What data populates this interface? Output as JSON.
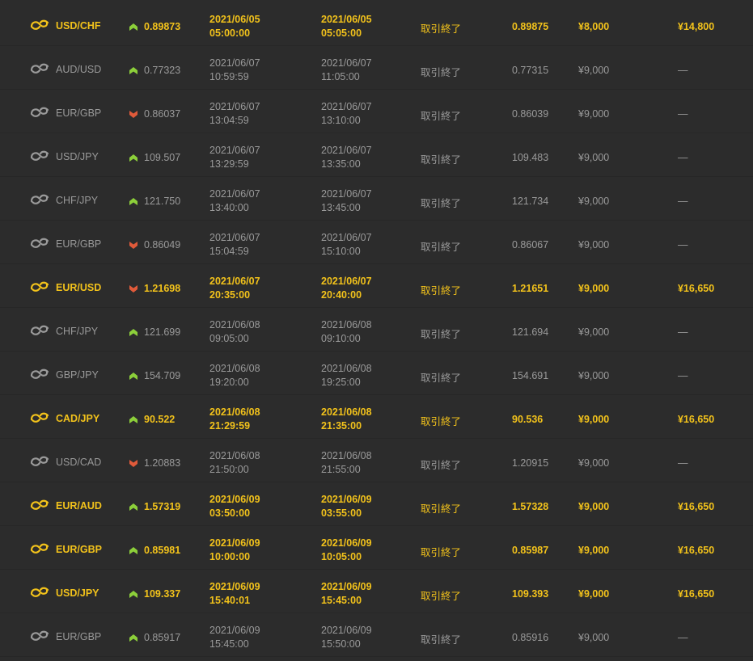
{
  "colors": {
    "background": "#2c2c2c",
    "win_text": "#f2c21b",
    "normal_text": "#9a9a9a",
    "up_arrow": "#8ccf3a",
    "down_arrow": "#e05a3a"
  },
  "icons": {
    "pair": "currency-exchange-icon",
    "up": "high-arrow-icon",
    "down": "low-arrow-icon"
  },
  "trades": [
    {
      "pair": "USD/CHF",
      "direction": "up",
      "entry_rate": "0.89873",
      "start_date": "2021/06/05",
      "start_time": "05:00:00",
      "end_date": "2021/06/05",
      "end_time": "05:05:00",
      "status": "取引終了",
      "close_rate": "0.89875",
      "invest": "¥8,000",
      "payout": "¥14,800",
      "win": true
    },
    {
      "pair": "AUD/USD",
      "direction": "up",
      "entry_rate": "0.77323",
      "start_date": "2021/06/07",
      "start_time": "10:59:59",
      "end_date": "2021/06/07",
      "end_time": "11:05:00",
      "status": "取引終了",
      "close_rate": "0.77315",
      "invest": "¥9,000",
      "payout": "—",
      "win": false
    },
    {
      "pair": "EUR/GBP",
      "direction": "down",
      "entry_rate": "0.86037",
      "start_date": "2021/06/07",
      "start_time": "13:04:59",
      "end_date": "2021/06/07",
      "end_time": "13:10:00",
      "status": "取引終了",
      "close_rate": "0.86039",
      "invest": "¥9,000",
      "payout": "—",
      "win": false
    },
    {
      "pair": "USD/JPY",
      "direction": "up",
      "entry_rate": "109.507",
      "start_date": "2021/06/07",
      "start_time": "13:29:59",
      "end_date": "2021/06/07",
      "end_time": "13:35:00",
      "status": "取引終了",
      "close_rate": "109.483",
      "invest": "¥9,000",
      "payout": "—",
      "win": false
    },
    {
      "pair": "CHF/JPY",
      "direction": "up",
      "entry_rate": "121.750",
      "start_date": "2021/06/07",
      "start_time": "13:40:00",
      "end_date": "2021/06/07",
      "end_time": "13:45:00",
      "status": "取引終了",
      "close_rate": "121.734",
      "invest": "¥9,000",
      "payout": "—",
      "win": false
    },
    {
      "pair": "EUR/GBP",
      "direction": "down",
      "entry_rate": "0.86049",
      "start_date": "2021/06/07",
      "start_time": "15:04:59",
      "end_date": "2021/06/07",
      "end_time": "15:10:00",
      "status": "取引終了",
      "close_rate": "0.86067",
      "invest": "¥9,000",
      "payout": "—",
      "win": false
    },
    {
      "pair": "EUR/USD",
      "direction": "down",
      "entry_rate": "1.21698",
      "start_date": "2021/06/07",
      "start_time": "20:35:00",
      "end_date": "2021/06/07",
      "end_time": "20:40:00",
      "status": "取引終了",
      "close_rate": "1.21651",
      "invest": "¥9,000",
      "payout": "¥16,650",
      "win": true
    },
    {
      "pair": "CHF/JPY",
      "direction": "up",
      "entry_rate": "121.699",
      "start_date": "2021/06/08",
      "start_time": "09:05:00",
      "end_date": "2021/06/08",
      "end_time": "09:10:00",
      "status": "取引終了",
      "close_rate": "121.694",
      "invest": "¥9,000",
      "payout": "—",
      "win": false
    },
    {
      "pair": "GBP/JPY",
      "direction": "up",
      "entry_rate": "154.709",
      "start_date": "2021/06/08",
      "start_time": "19:20:00",
      "end_date": "2021/06/08",
      "end_time": "19:25:00",
      "status": "取引終了",
      "close_rate": "154.691",
      "invest": "¥9,000",
      "payout": "—",
      "win": false
    },
    {
      "pair": "CAD/JPY",
      "direction": "up",
      "entry_rate": "90.522",
      "start_date": "2021/06/08",
      "start_time": "21:29:59",
      "end_date": "2021/06/08",
      "end_time": "21:35:00",
      "status": "取引終了",
      "close_rate": "90.536",
      "invest": "¥9,000",
      "payout": "¥16,650",
      "win": true
    },
    {
      "pair": "USD/CAD",
      "direction": "down",
      "entry_rate": "1.20883",
      "start_date": "2021/06/08",
      "start_time": "21:50:00",
      "end_date": "2021/06/08",
      "end_time": "21:55:00",
      "status": "取引終了",
      "close_rate": "1.20915",
      "invest": "¥9,000",
      "payout": "—",
      "win": false
    },
    {
      "pair": "EUR/AUD",
      "direction": "up",
      "entry_rate": "1.57319",
      "start_date": "2021/06/09",
      "start_time": "03:50:00",
      "end_date": "2021/06/09",
      "end_time": "03:55:00",
      "status": "取引終了",
      "close_rate": "1.57328",
      "invest": "¥9,000",
      "payout": "¥16,650",
      "win": true
    },
    {
      "pair": "EUR/GBP",
      "direction": "up",
      "entry_rate": "0.85981",
      "start_date": "2021/06/09",
      "start_time": "10:00:00",
      "end_date": "2021/06/09",
      "end_time": "10:05:00",
      "status": "取引終了",
      "close_rate": "0.85987",
      "invest": "¥9,000",
      "payout": "¥16,650",
      "win": true
    },
    {
      "pair": "USD/JPY",
      "direction": "up",
      "entry_rate": "109.337",
      "start_date": "2021/06/09",
      "start_time": "15:40:01",
      "end_date": "2021/06/09",
      "end_time": "15:45:00",
      "status": "取引終了",
      "close_rate": "109.393",
      "invest": "¥9,000",
      "payout": "¥16,650",
      "win": true
    },
    {
      "pair": "EUR/GBP",
      "direction": "up",
      "entry_rate": "0.85917",
      "start_date": "2021/06/09",
      "start_time": "15:45:00",
      "end_date": "2021/06/09",
      "end_time": "15:50:00",
      "status": "取引終了",
      "close_rate": "0.85916",
      "invest": "¥9,000",
      "payout": "—",
      "win": false
    }
  ]
}
